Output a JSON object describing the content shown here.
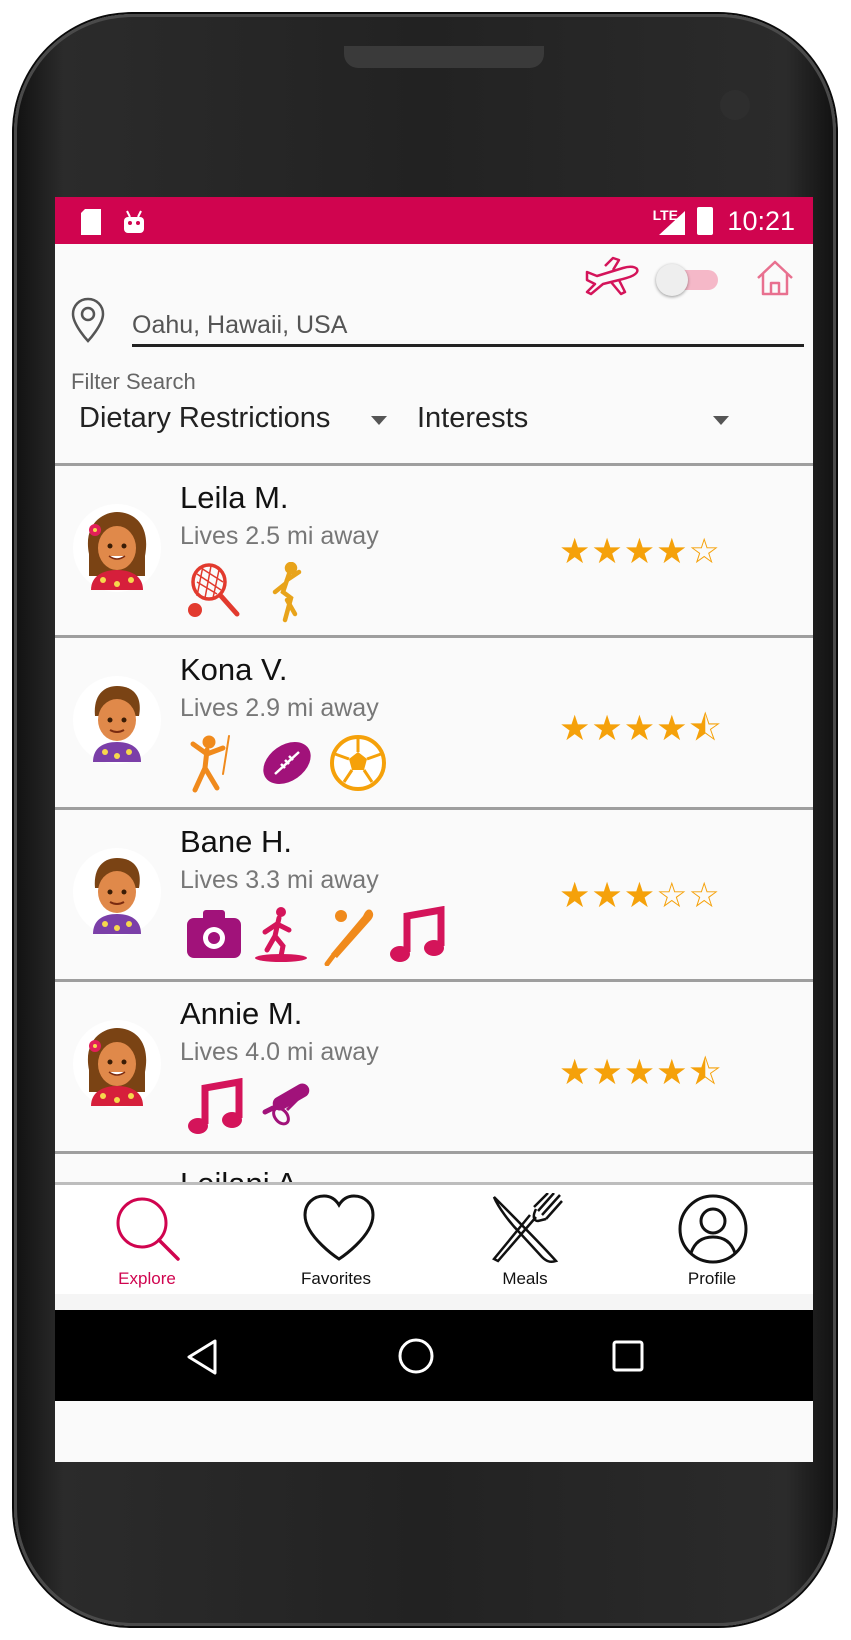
{
  "status_bar": {
    "time": "10:21",
    "network": "LTE"
  },
  "search": {
    "location": "Oahu, Hawaii, USA"
  },
  "filters": {
    "label": "Filter Search",
    "dietary": "Dietary Restrictions",
    "interests": "Interests"
  },
  "mode_toggle": {
    "checked": false
  },
  "hosts": [
    {
      "name": "Leila M.",
      "distance": "Lives 2.5 mi away",
      "rating": 4,
      "stars": "★★★★☆",
      "interests": [
        "tennis-icon",
        "dance-icon"
      ]
    },
    {
      "name": "Kona V.",
      "distance": "Lives 2.9 mi away",
      "rating": 4.5,
      "stars": "★★★★⯪",
      "interests": [
        "climbing-icon",
        "football-icon",
        "soccer-icon"
      ]
    },
    {
      "name": "Bane H.",
      "distance": "Lives 3.3 mi away",
      "rating": 3,
      "stars": "★★★☆☆",
      "interests": [
        "camera-icon",
        "surfing-icon",
        "baseball-icon",
        "music-icon"
      ]
    },
    {
      "name": "Annie M.",
      "distance": "Lives 4.0 mi away",
      "rating": 4.5,
      "stars": "★★★★⯪",
      "interests": [
        "music-icon",
        "baking-icon"
      ]
    }
  ],
  "peek_host": {
    "name": "Leilani A."
  },
  "bottom_nav": [
    {
      "label": "Explore",
      "active": true
    },
    {
      "label": "Favorites",
      "active": false
    },
    {
      "label": "Meals",
      "active": false
    },
    {
      "label": "Profile",
      "active": false
    }
  ],
  "colors": {
    "accent": "#d0044f",
    "star": "#f5a10a",
    "orange_icon": "#f08a1c",
    "magenta_icon": "#a1127a",
    "pink_icon": "#d4145a"
  }
}
